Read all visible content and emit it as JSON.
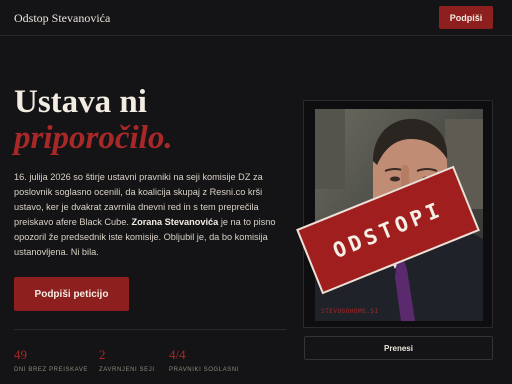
{
  "header": {
    "brand": "Odstop Stevanovića",
    "sign_button": "Podpiši"
  },
  "hero": {
    "title_line1": "Ustava ni",
    "title_line2": "priporočilo.",
    "body_pre": "16. julija 2026 so štirje ustavni pravniki na seji komisije DZ za poslovnik soglasno ocenili, da koalicija skupaj z Resni.co krši ustavo, ker je dvakrat zavrnila dnevni red in s tem preprečila preiskavo afere Black Cube.",
    "body_name": "Zorana Stevanovića",
    "body_post": "je na to pisno opozoril že predsednik iste komisije. Obljubil je, da bo komisija ustanovljena. Ni bila.",
    "cta_label": "Podpiši peticijo"
  },
  "stats": [
    {
      "value": "49",
      "label": "DNI BREZ PREISKAVE"
    },
    {
      "value": "2",
      "label": "ZAVRNJENI SEJI"
    },
    {
      "value": "4/4",
      "label": "PRAVNIKI SOGLASNI"
    }
  ],
  "photo": {
    "stamp_text": "ODSTOPI",
    "watermark": "STEVOGOHOME.SI"
  },
  "share_button": "Prenesi",
  "colors": {
    "accent": "#a82828",
    "button": "#8e1f1f",
    "background": "#141416"
  }
}
